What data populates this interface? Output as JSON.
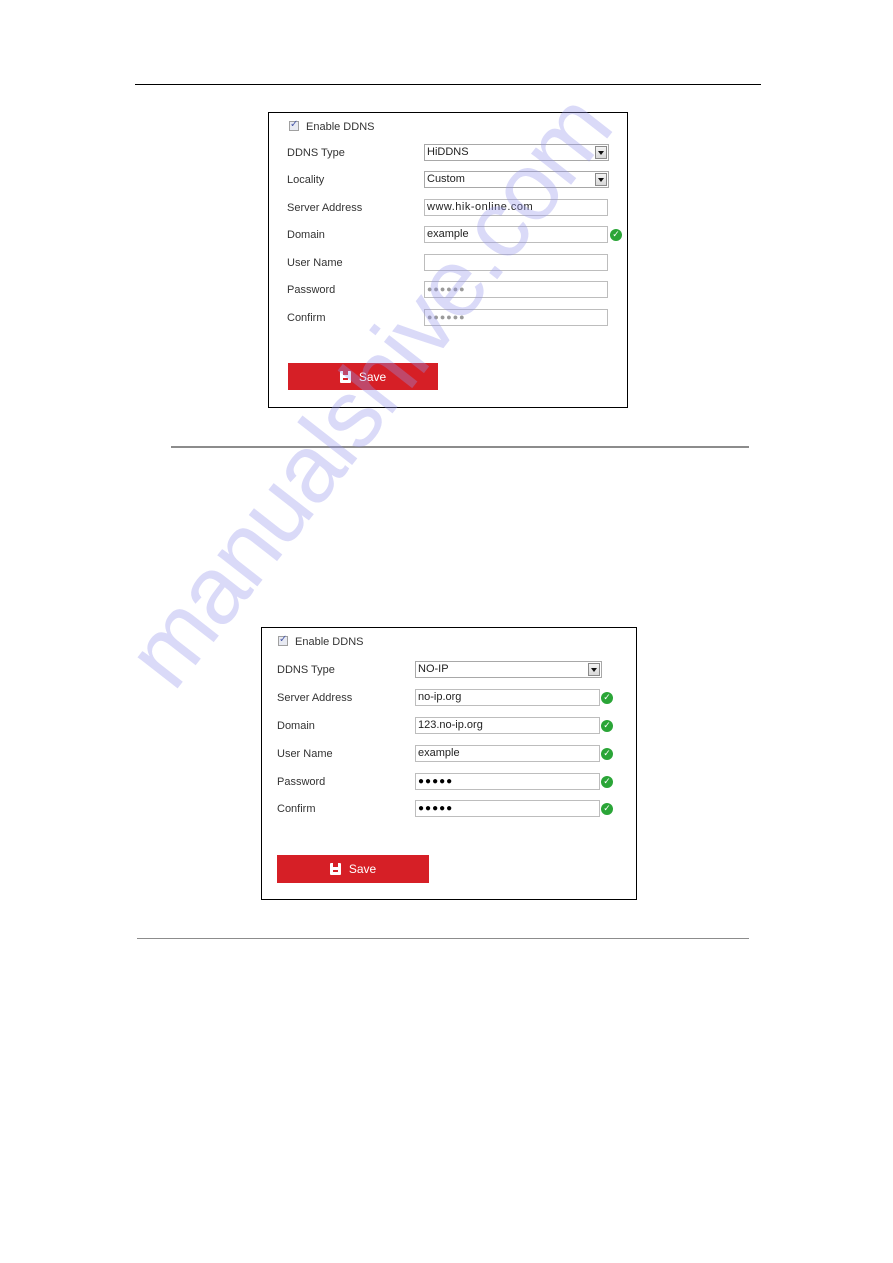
{
  "watermark": "manualshive.com",
  "form1": {
    "enable_label": "Enable DDNS",
    "enable_checked": true,
    "fields": [
      {
        "label": "DDNS Type",
        "value": "HiDDNS",
        "type": "select"
      },
      {
        "label": "Locality",
        "value": "Custom",
        "type": "select"
      },
      {
        "label": "Server Address",
        "value": "www.hik-online.com",
        "type": "text"
      },
      {
        "label": "Domain",
        "value": "example",
        "type": "text",
        "valid": true
      },
      {
        "label": "User Name",
        "value": "",
        "type": "text"
      },
      {
        "label": "Password",
        "value": "●●●●●●",
        "type": "password"
      },
      {
        "label": "Confirm",
        "value": "●●●●●●",
        "type": "password"
      }
    ],
    "save_label": "Save"
  },
  "form2": {
    "enable_label": "Enable DDNS",
    "enable_checked": true,
    "fields": [
      {
        "label": "DDNS Type",
        "value": "NO-IP",
        "type": "select"
      },
      {
        "label": "Server Address",
        "value": "no-ip.org",
        "type": "text",
        "valid": true
      },
      {
        "label": "Domain",
        "value": "123.no-ip.org",
        "type": "text",
        "valid": true
      },
      {
        "label": "User Name",
        "value": "example",
        "type": "text",
        "valid": true
      },
      {
        "label": "Password",
        "value": "●●●●●",
        "type": "password",
        "valid": true
      },
      {
        "label": "Confirm",
        "value": "●●●●●",
        "type": "password",
        "valid": true
      }
    ],
    "save_label": "Save"
  },
  "icons": {
    "valid": "✓"
  }
}
